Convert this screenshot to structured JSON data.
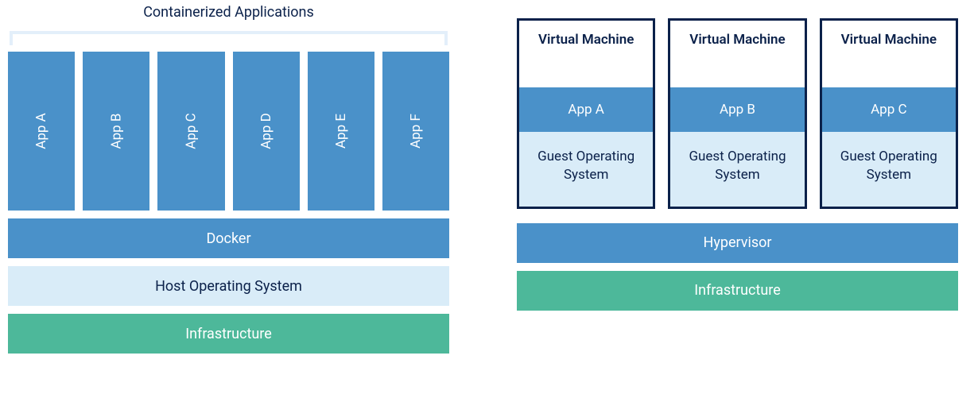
{
  "left": {
    "title": "Containerized Applications",
    "apps": [
      "App A",
      "App B",
      "App C",
      "App D",
      "App E",
      "App F"
    ],
    "docker": "Docker",
    "hostOs": "Host Operating System",
    "infra": "Infrastructure"
  },
  "right": {
    "vms": [
      {
        "title": "Virtual Machine",
        "app": "App A",
        "guest": "Guest Operating System"
      },
      {
        "title": "Virtual Machine",
        "app": "App B",
        "guest": "Guest Operating System"
      },
      {
        "title": "Virtual Machine",
        "app": "App C",
        "guest": "Guest Operating System"
      }
    ],
    "hypervisor": "Hypervisor",
    "infra": "Infrastructure"
  }
}
